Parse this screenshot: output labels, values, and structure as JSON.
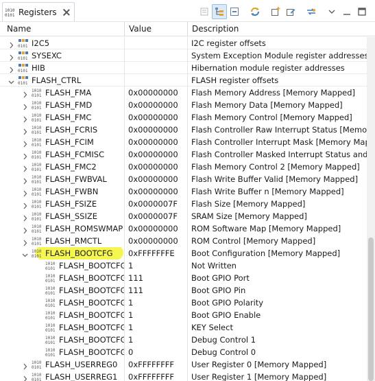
{
  "view": {
    "title": "Registers",
    "icon": "registers-icon"
  },
  "toolbar": {
    "buttons": [
      {
        "name": "clear-icon",
        "active": false
      },
      {
        "name": "tree-mode-icon",
        "active": true
      },
      {
        "name": "collapse-all-icon",
        "active": false
      },
      {
        "name": "refresh-icon",
        "active": false
      },
      {
        "name": "new-group-icon",
        "active": false
      },
      {
        "name": "edit-group-icon",
        "active": false
      },
      {
        "name": "sync-icon",
        "active": false
      },
      {
        "name": "view-menu-icon",
        "active": false
      },
      {
        "name": "minimize-icon",
        "active": false
      },
      {
        "name": "maximize-icon",
        "active": false
      }
    ]
  },
  "columns": {
    "name": "Name",
    "value": "Value",
    "description": "Description"
  },
  "colors": {
    "highlight": "#f5f542",
    "selection": "#dce9f7"
  },
  "rows": [
    {
      "level": 0,
      "type": "group",
      "expanded": false,
      "name": "I2C5",
      "value": "",
      "description": "I2C register offsets"
    },
    {
      "level": 0,
      "type": "group",
      "expanded": false,
      "name": "SYSEXC",
      "value": "",
      "description": "System Exception Module register addresses"
    },
    {
      "level": 0,
      "type": "group",
      "expanded": false,
      "name": "HIB",
      "value": "",
      "description": "Hibernation module register addresses"
    },
    {
      "level": 0,
      "type": "group",
      "expanded": true,
      "name": "FLASH_CTRL",
      "value": "",
      "description": "FLASH register offsets"
    },
    {
      "level": 1,
      "type": "register",
      "expanded": false,
      "name": "FLASH_FMA",
      "value": "0x00000000",
      "description": "Flash Memory Address [Memory Mapped]"
    },
    {
      "level": 1,
      "type": "register",
      "expanded": false,
      "name": "FLASH_FMD",
      "value": "0x00000000",
      "description": "Flash Memory Data [Memory Mapped]"
    },
    {
      "level": 1,
      "type": "register",
      "expanded": false,
      "name": "FLASH_FMC",
      "value": "0x00000000",
      "description": "Flash Memory Control [Memory Mapped]"
    },
    {
      "level": 1,
      "type": "register",
      "expanded": false,
      "name": "FLASH_FCRIS",
      "value": "0x00000000",
      "description": "Flash Controller Raw Interrupt Status [Memory M"
    },
    {
      "level": 1,
      "type": "register",
      "expanded": false,
      "name": "FLASH_FCIM",
      "value": "0x00000000",
      "description": "Flash Controller Interrupt Mask [Memory Mappe"
    },
    {
      "level": 1,
      "type": "register",
      "expanded": false,
      "name": "FLASH_FCMISC",
      "value": "0x00000000",
      "description": "Flash Controller Masked Interrupt Status and Clea"
    },
    {
      "level": 1,
      "type": "register",
      "expanded": false,
      "name": "FLASH_FMC2",
      "value": "0x00000000",
      "description": "Flash Memory Control 2 [Memory Mapped]"
    },
    {
      "level": 1,
      "type": "register",
      "expanded": false,
      "name": "FLASH_FWBVAL",
      "value": "0x00000000",
      "description": "Flash Write Buffer Valid [Memory Mapped]"
    },
    {
      "level": 1,
      "type": "register",
      "expanded": false,
      "name": "FLASH_FWBN",
      "value": "0x00000000",
      "description": "Flash Write Buffer n [Memory Mapped]"
    },
    {
      "level": 1,
      "type": "register",
      "expanded": false,
      "name": "FLASH_FSIZE",
      "value": "0x0000007F",
      "description": "Flash Size [Memory Mapped]"
    },
    {
      "level": 1,
      "type": "register",
      "expanded": false,
      "name": "FLASH_SSIZE",
      "value": "0x0000007F",
      "description": "SRAM Size [Memory Mapped]"
    },
    {
      "level": 1,
      "type": "register",
      "expanded": false,
      "name": "FLASH_ROMSWMAP",
      "value": "0x00000000",
      "description": "ROM Software Map [Memory Mapped]"
    },
    {
      "level": 1,
      "type": "register",
      "expanded": false,
      "name": "FLASH_RMCTL",
      "value": "0x00000000",
      "description": "ROM Control [Memory Mapped]"
    },
    {
      "level": 1,
      "type": "register",
      "expanded": true,
      "highlighted": true,
      "name": "FLASH_BOOTCFG",
      "value": "0xFFFFFFFE",
      "description": "Boot Configuration [Memory Mapped]"
    },
    {
      "level": 2,
      "type": "field",
      "name": "FLASH_BOOTCFG_",
      "value": "1",
      "description": "Not Written"
    },
    {
      "level": 2,
      "type": "field",
      "name": "FLASH_BOOTCFG_",
      "value": "111",
      "description": "Boot GPIO Port"
    },
    {
      "level": 2,
      "type": "field",
      "name": "FLASH_BOOTCFG_",
      "value": "111",
      "description": "Boot GPIO Pin"
    },
    {
      "level": 2,
      "type": "field",
      "name": "FLASH_BOOTCFG_",
      "value": "1",
      "description": "Boot GPIO Polarity"
    },
    {
      "level": 2,
      "type": "field",
      "name": "FLASH_BOOTCFG_",
      "value": "1",
      "description": "Boot GPIO Enable"
    },
    {
      "level": 2,
      "type": "field",
      "name": "FLASH_BOOTCFG_",
      "value": "1",
      "description": "KEY Select"
    },
    {
      "level": 2,
      "type": "field",
      "name": "FLASH_BOOTCFG_",
      "value": "1",
      "description": "Debug Control 1"
    },
    {
      "level": 2,
      "type": "field",
      "name": "FLASH_BOOTCFG_",
      "value": "0",
      "description": "Debug Control 0"
    },
    {
      "level": 1,
      "type": "register",
      "expanded": false,
      "name": "FLASH_USERREG0",
      "value": "0xFFFFFFFF",
      "description": "User Register 0 [Memory Mapped]"
    },
    {
      "level": 1,
      "type": "register",
      "expanded": false,
      "name": "FLASH_USERREG1",
      "value": "0xFFFFFFFF",
      "description": "User Register 1 [Memory Mapped]"
    }
  ]
}
